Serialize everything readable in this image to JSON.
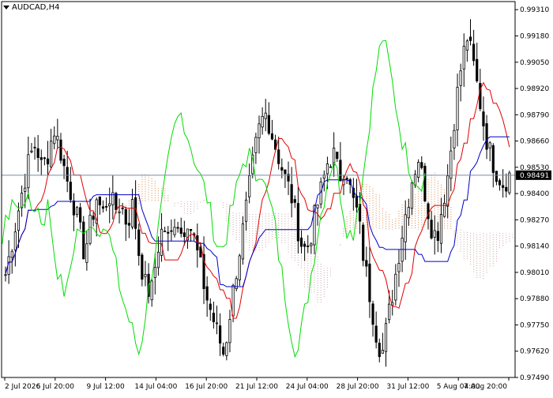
{
  "header": {
    "symbol": "AUDCAD,H4"
  },
  "colors": {
    "background": "#ffffff",
    "frame": "#000000",
    "candle": "#000000",
    "tenkan": "#e00000",
    "kijun": "#0000c8",
    "chikou": "#00dd00",
    "kumo_a": "#d2691e",
    "kumo_b": "#bc8f8f",
    "price_line": "#7a8aa8",
    "price_tag": "#000000",
    "price_tag_text": "#ffffff"
  },
  "chart_data": {
    "type": "candlestick",
    "symbol": "AUDCAD",
    "timeframe": "H4",
    "ylim": [
      0.9749,
      0.9935
    ],
    "y_ticks": [
      "0.99310",
      "0.99180",
      "0.99050",
      "0.98920",
      "0.98790",
      "0.98660",
      "0.98530",
      "0.98400",
      "0.98270",
      "0.98140",
      "0.98010",
      "0.97880",
      "0.97750",
      "0.97620",
      "0.97490"
    ],
    "x_ticks": [
      "2 Jul 2026",
      "6 Jul 20:00",
      "9 Jul 12:00",
      "14 Jul 04:00",
      "16 Jul 20:00",
      "21 Jul 12:00",
      "24 Jul 04:00",
      "28 Jul 20:00",
      "31 Jul 12:00",
      "5 Aug 04:00",
      "7 Aug 20:00"
    ],
    "current_price": "0.98491",
    "close_path": [
      0.98,
      0.9815,
      0.983,
      0.9845,
      0.9858,
      0.9865,
      0.9852,
      0.986,
      0.9872,
      0.9862,
      0.9848,
      0.9838,
      0.9825,
      0.981,
      0.9825,
      0.9838,
      0.983,
      0.984,
      0.9832,
      0.9835,
      0.9825,
      0.9835,
      0.981,
      0.9795,
      0.979,
      0.9812,
      0.9825,
      0.9815,
      0.983,
      0.982,
      0.9828,
      0.9818,
      0.9805,
      0.979,
      0.978,
      0.977,
      0.976,
      0.9782,
      0.9802,
      0.982,
      0.984,
      0.986,
      0.9875,
      0.988,
      0.9868,
      0.9858,
      0.9848,
      0.984,
      0.9825,
      0.9812,
      0.9815,
      0.983,
      0.9842,
      0.9855,
      0.986,
      0.9848,
      0.9855,
      0.9838,
      0.983,
      0.9808,
      0.979,
      0.9772,
      0.976,
      0.9778,
      0.9795,
      0.9815,
      0.9832,
      0.9848,
      0.9858,
      0.9842,
      0.9825,
      0.9818,
      0.9835,
      0.9852,
      0.988,
      0.9902,
      0.9918,
      0.9905,
      0.9888,
      0.987,
      0.9858,
      0.985,
      0.9845,
      0.9849
    ]
  }
}
